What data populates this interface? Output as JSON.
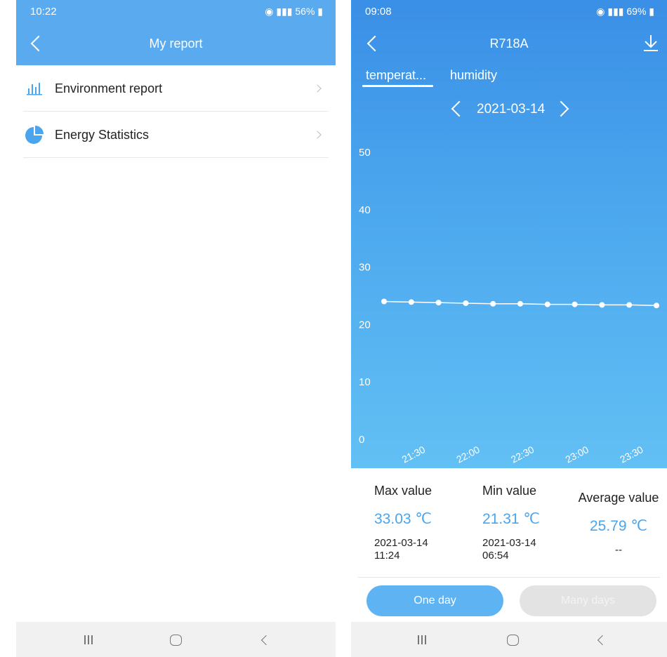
{
  "left_screen": {
    "status_bar": {
      "time": "10:22",
      "battery": "56%"
    },
    "header": {
      "title": "My report"
    },
    "menu": [
      {
        "label": "Environment report",
        "icon": "bar-chart-icon"
      },
      {
        "label": "Energy Statistics",
        "icon": "pie-chart-icon"
      }
    ]
  },
  "right_screen": {
    "status_bar": {
      "time": "09:08",
      "battery": "69%"
    },
    "header": {
      "title": "R718A"
    },
    "tabs": [
      {
        "label": "temperat...",
        "active": true
      },
      {
        "label": "humidity",
        "active": false
      }
    ],
    "date": "2021-03-14",
    "stats": {
      "max": {
        "label": "Max value",
        "value": "33.03 ℃",
        "time_date": "2021-03-14",
        "time_clock": "11:24"
      },
      "min": {
        "label": "Min value",
        "value": "21.31 ℃",
        "time_date": "2021-03-14",
        "time_clock": "06:54"
      },
      "avg": {
        "label": "Average value",
        "value": "25.79 ℃",
        "time": "--"
      }
    },
    "buttons": {
      "one_day": "One day",
      "many_days": "Many days"
    }
  },
  "colors": {
    "accent": "#5aaaf0",
    "value_blue": "#4aa5ee",
    "disabled": "#e3e3e3"
  },
  "chart_data": {
    "type": "line",
    "x_tick_labels": [
      "21:30",
      "22:00",
      "22:30",
      "23:00",
      "23:30"
    ],
    "x": [
      "21:15",
      "21:30",
      "21:45",
      "22:00",
      "22:15",
      "22:30",
      "22:45",
      "23:00",
      "23:15",
      "23:30",
      "23:45"
    ],
    "y_ticks": [
      0,
      10,
      20,
      30,
      40,
      50
    ],
    "ylim": [
      0,
      50
    ],
    "series": [
      {
        "values": [
          23.9,
          23.8,
          23.7,
          23.6,
          23.5,
          23.5,
          23.4,
          23.4,
          23.3,
          23.3,
          23.2
        ]
      }
    ],
    "grid": false
  }
}
